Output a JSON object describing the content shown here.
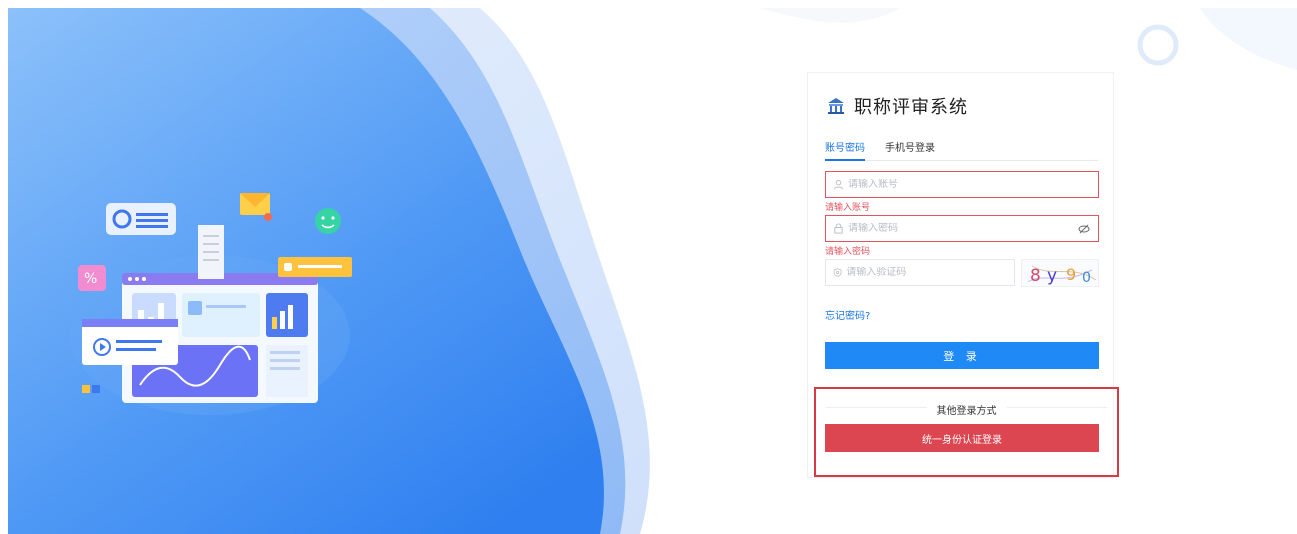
{
  "app": {
    "title": "职称评审系统"
  },
  "tabs": [
    {
      "label": "账号密码",
      "active": true
    },
    {
      "label": "手机号登录",
      "active": false
    }
  ],
  "form": {
    "account": {
      "placeholder": "请输入账号",
      "value": "",
      "error": "请输入账号"
    },
    "password": {
      "placeholder": "请输入密码",
      "value": "",
      "error": "请输入密码"
    },
    "captcha": {
      "placeholder": "请输入验证码",
      "value": "",
      "image_text": "8y90"
    },
    "forgot_label": "忘记密码?",
    "login_label": "登 录"
  },
  "other_login": {
    "title": "其他登录方式",
    "uia_label": "统一身份认证登录"
  },
  "icons": {
    "logo": "building-icon",
    "account": "user-icon",
    "password": "lock-icon",
    "captcha": "shield-icon",
    "eye": "eye-off-icon"
  },
  "colors": {
    "primary": "#1f8af5",
    "danger": "#db4651",
    "error_text": "#e2545e",
    "highlight_border": "#d63a42"
  }
}
